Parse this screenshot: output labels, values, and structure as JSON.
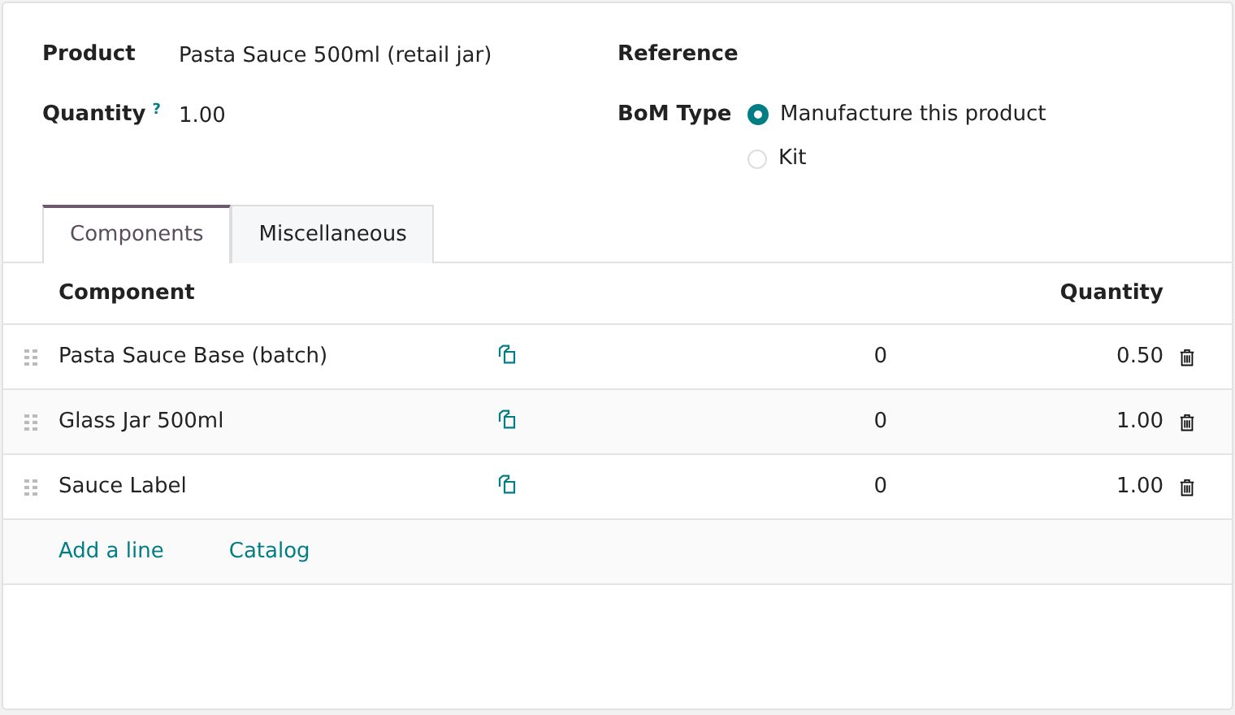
{
  "fields_left": [
    {
      "label": "Product",
      "value": "Pasta Sauce 500ml (retail jar)"
    },
    {
      "label": "Quantity",
      "value": "1.00",
      "help": "?"
    }
  ],
  "fields_right": [
    {
      "label": "Reference"
    },
    {
      "label": "BoM Type",
      "options": [
        {
          "label": "Manufacture this product",
          "selected": true
        },
        {
          "label": "Kit",
          "selected": false
        }
      ]
    }
  ],
  "tabs": [
    {
      "label": "Components",
      "selected": true
    },
    {
      "label": "Miscellaneous",
      "selected": false
    }
  ],
  "table": {
    "columns": [
      "Component",
      "Quantity"
    ],
    "rows": [
      {
        "component": "Pasta Sauce Base (batch)",
        "column_3": "0",
        "quantity": "0.50"
      },
      {
        "component": "Glass Jar 500ml",
        "column_3": "0",
        "quantity": "1.00"
      },
      {
        "component": "Sauce Label",
        "column_3": "0",
        "quantity": "1.00"
      }
    ],
    "actions": [
      "Add a line",
      "Catalog"
    ]
  }
}
